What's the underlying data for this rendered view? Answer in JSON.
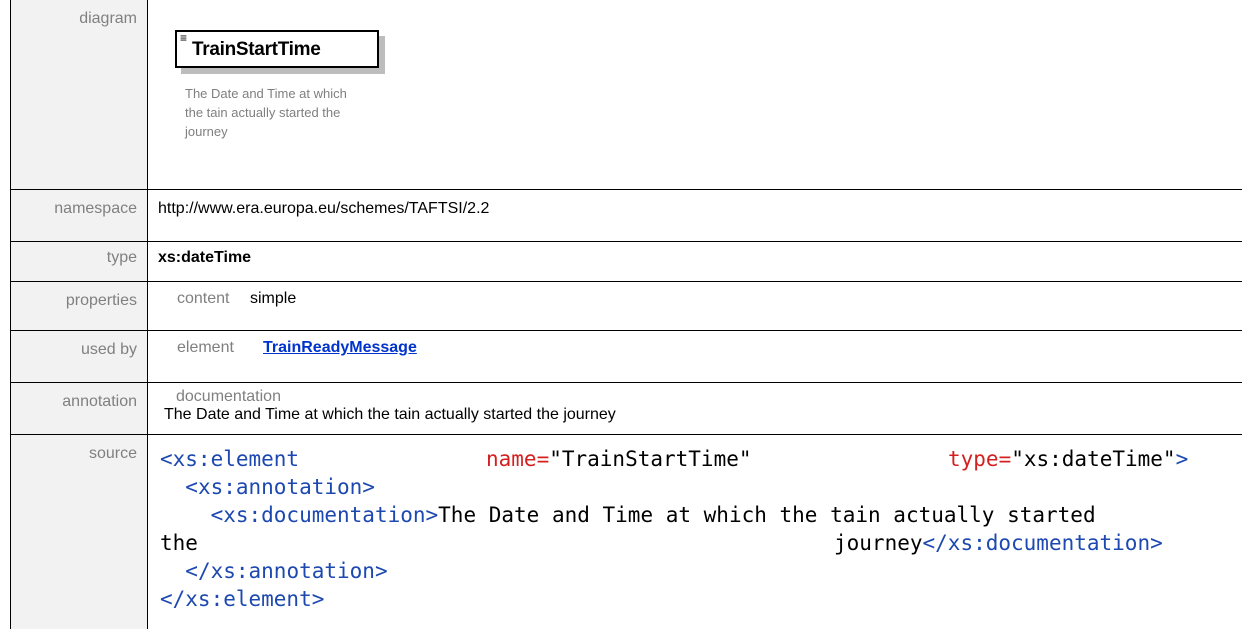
{
  "labels": {
    "diagram": "diagram",
    "namespace": "namespace",
    "type": "type",
    "properties": "properties",
    "used_by": "used by",
    "annotation": "annotation",
    "source": "source"
  },
  "diagram": {
    "element_name": "TrainStartTime",
    "element_glyph": "≡",
    "doc_lines": [
      "The Date and Time at which",
      "the tain actually started the",
      "journey"
    ]
  },
  "namespace": "http://www.era.europa.eu/schemes/TAFTSI/2.2",
  "type": "xs:dateTime",
  "properties": {
    "key": "content",
    "value": "simple"
  },
  "used_by": {
    "key": "element",
    "link": "TrainReadyMessage"
  },
  "annotation": {
    "key": "documentation",
    "text": "The Date and Time at which the tain actually started the journey"
  },
  "source": {
    "l1_open": "<xs:element",
    "l1_attr1": "name=",
    "l1_val1": "\"TrainStartTime\"",
    "l1_attr2": "type=",
    "l1_val2": "\"xs:dateTime\"",
    "l1_close": ">",
    "l2": "<xs:annotation>",
    "l3_open": "<xs:documentation>",
    "l3_text": "The Date and Time at which the tain actually started",
    "l4_text_a": "the",
    "l4_text_b": "journey",
    "l4_close": "</xs:documentation>",
    "l5": "</xs:annotation>",
    "l6": "</xs:element>"
  }
}
